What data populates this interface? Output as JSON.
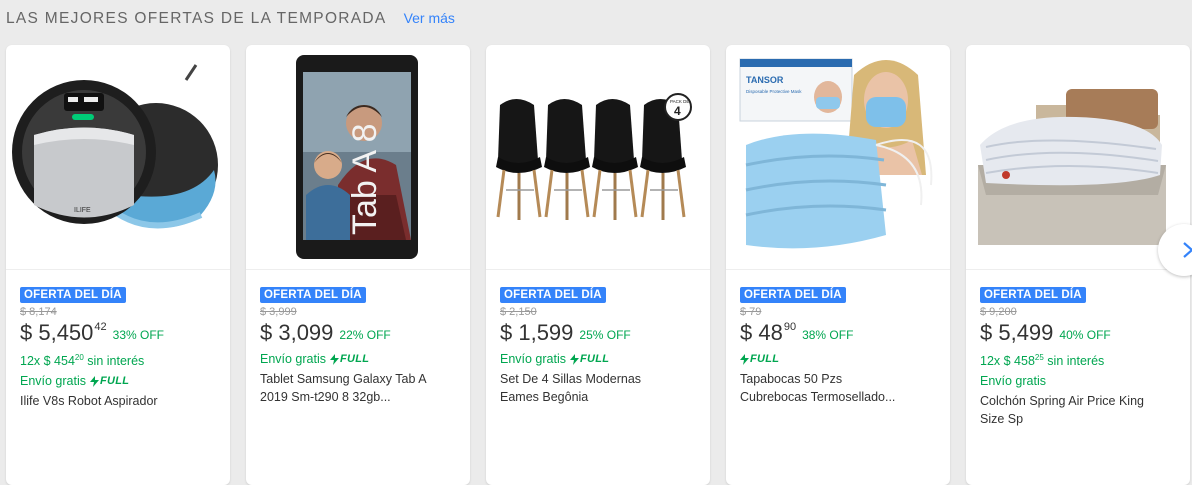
{
  "section": {
    "title": "LAS MEJORES OFERTAS DE LA TEMPORADA",
    "see_more": "Ver más"
  },
  "colors": {
    "accent": "#3483fa",
    "green": "#00a650",
    "background": "#ebebeb"
  },
  "cards": [
    {
      "badge": "OFERTA DEL DÍA",
      "old_price": "$ 8,174",
      "price": "$ 5,450",
      "cents": "42",
      "discount": "33% OFF",
      "installment_prefix": "12x $ 454",
      "installment_cents": "20",
      "installment_suffix": " sin interés",
      "shipping": "Envío gratis",
      "full": "FULL",
      "title": "Ilife V8s Robot Aspirador",
      "image": "robot-vacuum-image"
    },
    {
      "badge": "OFERTA DEL DÍA",
      "old_price": "$ 3,999",
      "price": "$ 3,099",
      "discount": "22% OFF",
      "shipping": "Envío gratis",
      "full": "FULL",
      "title": "Tablet Samsung Galaxy Tab A 2019 Sm-t290 8 32gb...",
      "tablet_text": "Tab A 8",
      "image": "tablet-image"
    },
    {
      "badge": "OFERTA DEL DÍA",
      "old_price": "$ 2,150",
      "price": "$ 1,599",
      "discount": "25% OFF",
      "shipping": "Envío gratis",
      "full": "FULL",
      "title": "Set De 4 Sillas Modernas Eames Begônia",
      "pack_label": "PACK DE",
      "pack_count": "4",
      "image": "chairs-image"
    },
    {
      "badge": "OFERTA DEL DÍA",
      "old_price": "$ 79",
      "price": "$ 48",
      "cents": "90",
      "discount": "38% OFF",
      "full": "FULL",
      "title": "Tapabocas 50 Pzs Cubrebocas Termosellado...",
      "box_brand": "TANSOR",
      "box_sub": "Disposable Protective Mask",
      "image": "face-masks-image"
    },
    {
      "badge": "OFERTA DEL DÍA",
      "old_price": "$ 9,200",
      "price": "$ 5,499",
      "discount": "40% OFF",
      "installment_prefix": "12x $ 458",
      "installment_cents": "25",
      "installment_suffix": " sin interés",
      "shipping": "Envío gratis",
      "title": "Colchón Spring Air Price King Size Sp",
      "image": "mattress-image"
    }
  ],
  "nav": {
    "icon": "chevron-right-icon"
  }
}
